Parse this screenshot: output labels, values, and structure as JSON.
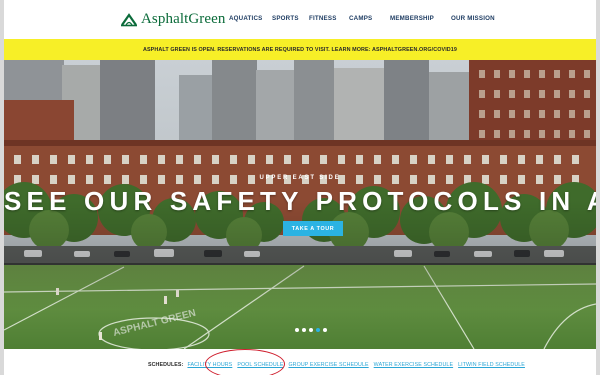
{
  "header": {
    "logo_text": "AsphaltGreen",
    "nav": [
      {
        "label": "AQUATICS"
      },
      {
        "label": "SPORTS"
      },
      {
        "label": "FITNESS"
      },
      {
        "label": "CAMPS"
      },
      {
        "label": "MEMBERSHIP"
      },
      {
        "label": "OUR MISSION"
      }
    ]
  },
  "banner": {
    "text": "ASPHALT GREEN IS OPEN. RESERVATIONS ARE REQUIRED TO VISIT. LEARN MORE: ",
    "link": "ASPHALTGREEN.ORG/COVID19"
  },
  "hero": {
    "eyebrow": "UPPER EAST SIDE",
    "headline": "SEE OUR SAFETY PROTOCOLS IN ACTION",
    "cta": "TAKE A TOUR",
    "slides": 5,
    "active_slide": 4
  },
  "schedules": {
    "label": "SCHEDULES:",
    "links": [
      {
        "label": "FACILITY HOURS"
      },
      {
        "label": "POOL SCHEDULE"
      },
      {
        "label": "GROUP EXERCISE SCHEDULE"
      },
      {
        "label": "WATER EXERCISE SCHEDULE"
      },
      {
        "label": "LITWIN FIELD SCHEDULE"
      }
    ]
  },
  "colors": {
    "banner": "#f7ef27",
    "accent": "#2bb3e3",
    "nav_text": "#1f3d63",
    "logo": "#0b6b3a",
    "annotation": "#cf1f2e"
  },
  "icons": {
    "logo": "asphalt-green-logo-icon"
  }
}
